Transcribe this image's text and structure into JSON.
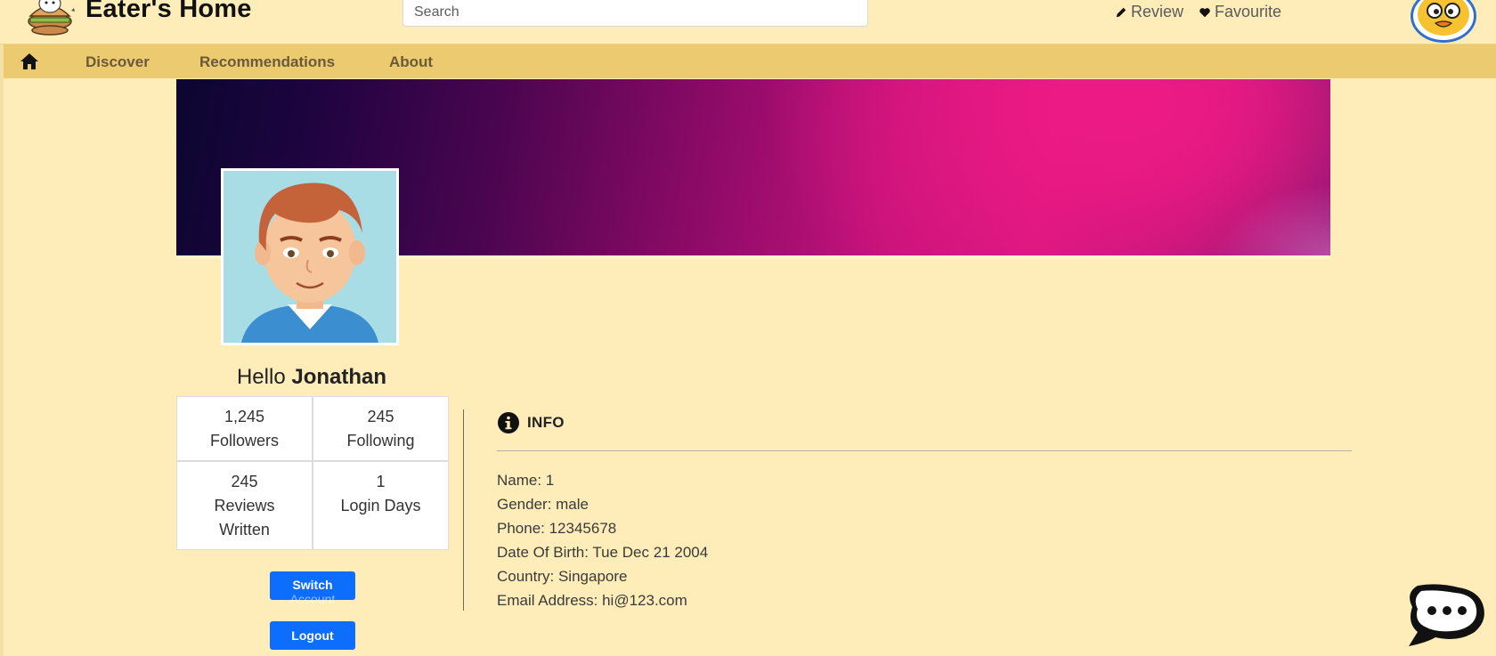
{
  "header": {
    "brand": "Eater's Home",
    "search_placeholder": "Search",
    "review_label": "Review",
    "favourite_label": "Favourite"
  },
  "nav": {
    "discover": "Discover",
    "recommendations": "Recommendations",
    "about": "About"
  },
  "profile": {
    "hello_prefix": "Hello",
    "username": "Jonathan",
    "stats": [
      {
        "value": "1,245",
        "label": "Followers"
      },
      {
        "value": "245",
        "label": "Following"
      },
      {
        "value": "245",
        "label": "Reviews Written"
      },
      {
        "value": "1",
        "label": "Login Days"
      }
    ],
    "switch_label_1": "Switch",
    "switch_label_2": "Account",
    "logout_label": "Logout"
  },
  "info": {
    "title": "INFO",
    "name": "Name: 1",
    "gender": "Gender: male",
    "phone": "Phone: 12345678",
    "dob": "Date Of Birth: Tue Dec 21 2004",
    "country": "Country: Singapore",
    "email": "Email Address: hi@123.com"
  },
  "icons": {
    "home": "home-icon",
    "review": "pencil-icon",
    "favourite": "heart-icon",
    "info": "info-circle-icon",
    "chat": "chat-bubble-icon"
  },
  "colors": {
    "page_bg": "#feedb9",
    "navbar_bg": "#ecca70",
    "button_blue": "#0d6efd",
    "banner_pink": "#ee1a84"
  }
}
